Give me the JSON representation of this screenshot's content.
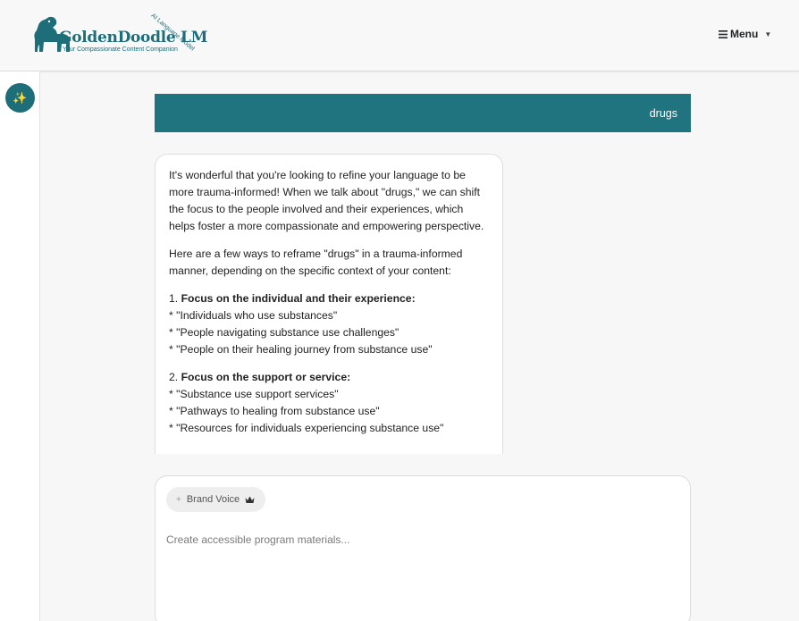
{
  "header": {
    "logo_name": "GoldenDoodle LM",
    "logo_tagline": "Your Compassionate Content Companion",
    "logo_arc_text": "AI Language Model",
    "menu_label": "Menu"
  },
  "sidebar": {
    "spark_button_glyph": "✨"
  },
  "chat": {
    "user_message": "drugs",
    "assistant": {
      "intro": "It's wonderful that you're looking to refine your language to be more trauma-informed! When we talk about \"drugs,\" we can shift the focus to the people involved and their experiences, which helps foster a more compassionate and empowering perspective.",
      "lead": "Here are a few ways to reframe \"drugs\" in a trauma-informed manner, depending on the specific context of your content:",
      "sections": [
        {
          "number": "1.",
          "heading": "Focus on the individual and their experience:",
          "items": [
            "* \"Individuals who use substances\"",
            "* \"People navigating substance use challenges\"",
            "* \"People on their healing journey from substance use\""
          ]
        },
        {
          "number": "2.",
          "heading": "Focus on the support or service:",
          "items": [
            "* \"Substance use support services\"",
            "* \"Pathways to healing from substance use\"",
            "* \"Resources for individuals experiencing substance use\""
          ]
        }
      ]
    }
  },
  "composer": {
    "chip_label": "Brand Voice",
    "chip_plus": "+",
    "chip_icon": "crown-icon",
    "placeholder": "Create accessible program materials..."
  },
  "colors": {
    "brand_teal": "#1f7480",
    "spark_yellow": "#ffd54f"
  }
}
